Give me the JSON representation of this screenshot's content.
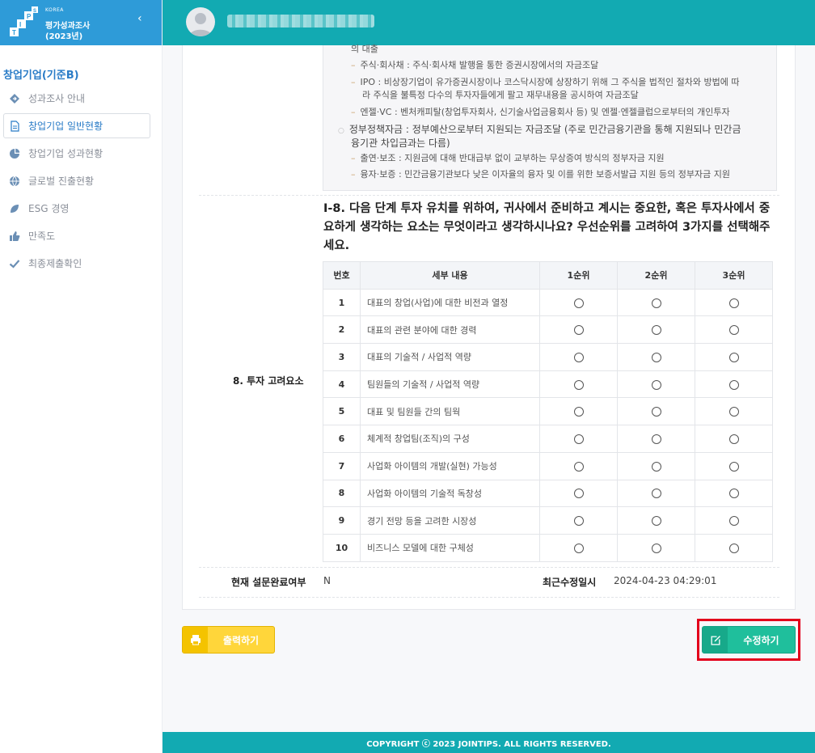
{
  "brand": {
    "logo_letters": [
      "I",
      "P",
      "S",
      "T"
    ],
    "korea": "KOREA",
    "line1": "평가성과조사",
    "line2": "(2023년)"
  },
  "sidebar": {
    "group_title": "창업기업(기준B)",
    "items": [
      {
        "label": "성과조사 안내",
        "icon": "diamond-icon"
      },
      {
        "label": "창업기업 일반현황",
        "icon": "document-icon",
        "active": true
      },
      {
        "label": "창업기업 성과현황",
        "icon": "pie-chart-icon"
      },
      {
        "label": "글로벌 진출현황",
        "icon": "globe-icon"
      },
      {
        "label": "ESG 경영",
        "icon": "leaf-icon"
      },
      {
        "label": "만족도",
        "icon": "thumbs-up-icon"
      },
      {
        "label": "최종제출확인",
        "icon": "check-icon"
      }
    ]
  },
  "info_box": {
    "l0": "의 대출",
    "l1": "주식·회사채 : 주식·회사채 발행을 통한 증권시장에서의 자금조달",
    "l2a": "IPO : 비상장기업이 유가증권시장이나 코스닥시장에 상장하기 위해 그 주식을 법적인 절차와 방법에 따",
    "l2b": "라 주식을 불특정 다수의 투자자들에게 팔고 재무내용을 공시하여 자금조달",
    "l3": "엔젤·VC : 벤처캐피탈(창업투자회사, 신기술사업금융회사 등) 및 엔젤·엔젤클럽으로부터의 개인투자",
    "l4a": "정부정책자금 : 정부예산으로부터 지원되는 자금조달 (주로 민간금융기관을 통해 지원되나 민간금",
    "l4b": "융기관 차입금과는 다름)",
    "l5": "출연·보조 : 지원금에 대해 반대급부 없이 교부하는 무상증여 방식의 정부자금 지원",
    "l6": "융자·보증 : 민간금융기관보다 낮은 이자율의 융자 및 이를 위한 보증서발급 지원 등의 정부자금 지원"
  },
  "question": {
    "text": "I-8. 다음 단계 투자 유치를 위하여, 귀사에서 준비하고 계시는 중요한, 혹은 투자사에서 중요하게 생각하는 요소는 무엇이라고 생각하시나요? 우선순위를 고려하여 3가지를 선택해주세요.",
    "row_label": "8. 투자 고려요소"
  },
  "table": {
    "headers": [
      "번호",
      "세부 내용",
      "1순위",
      "2순위",
      "3순위"
    ],
    "rows": [
      {
        "no": "1",
        "desc": "대표의 창업(사업)에 대한 비전과 열정"
      },
      {
        "no": "2",
        "desc": "대표의 관련 분야에 대한 경력"
      },
      {
        "no": "3",
        "desc": "대표의 기술적 / 사업적 역량"
      },
      {
        "no": "4",
        "desc": "팀원들의 기술적 / 사업적 역량"
      },
      {
        "no": "5",
        "desc": "대표 및 팀원들 간의 팀웍"
      },
      {
        "no": "6",
        "desc": "체계적 창업팀(조직)의 구성"
      },
      {
        "no": "7",
        "desc": "사업화 아이템의 개발(실현) 가능성"
      },
      {
        "no": "8",
        "desc": "사업화 아이템의 기술적 독창성"
      },
      {
        "no": "9",
        "desc": "경기 전망 등을 고려한 시장성"
      },
      {
        "no": "10",
        "desc": "비즈니스 모델에 대한 구체성"
      }
    ]
  },
  "status": {
    "label": "현재 설문완료여부",
    "value": "N",
    "modified_label": "최근수정일시",
    "modified_value": "2024-04-23 04:29:01"
  },
  "buttons": {
    "print": "출력하기",
    "edit": "수정하기"
  },
  "footer": "COPYRIGHT ⓒ 2023 JOINTIPS. ALL RIGHTS RESERVED.",
  "colors": {
    "topbar": "#12aab2",
    "brand": "#2e9bd8",
    "accent_blue": "#2a7cc7",
    "print_button": "#ffd63a",
    "edit_button": "#1fbf9c",
    "highlight": "#e3001b"
  }
}
